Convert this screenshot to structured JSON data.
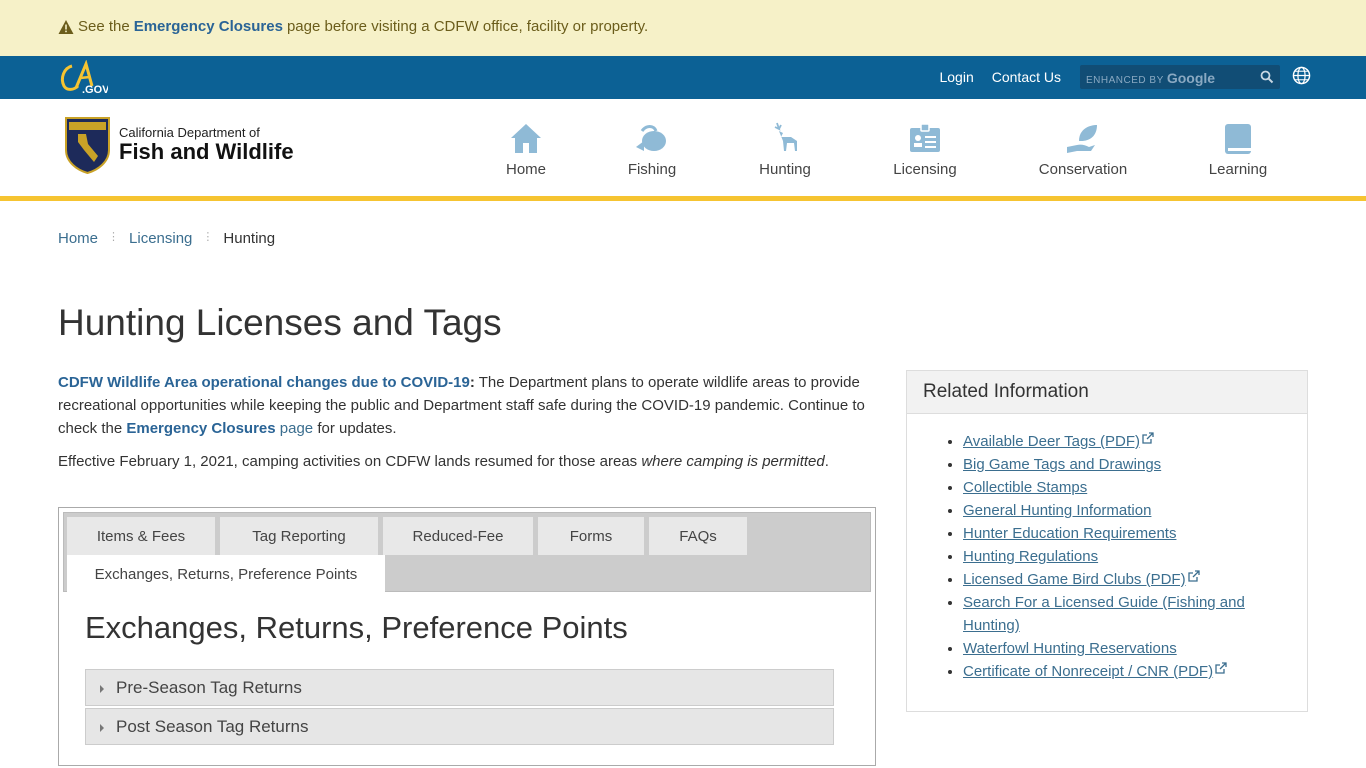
{
  "alert": {
    "prefix": "See the ",
    "link": "Emergency Closures",
    "suffix": " page before visiting a CDFW office, facility or property."
  },
  "topbar": {
    "logo_alt": "CA.GOV",
    "login": "Login",
    "contact": "Contact Us",
    "search_placeholder_small": "ENHANCED BY",
    "search_placeholder_brand": "Google"
  },
  "header": {
    "org_line1": "California Department of",
    "org_line2": "Fish and Wildlife",
    "nav": [
      {
        "label": "Home",
        "icon": "home-icon"
      },
      {
        "label": "Fishing",
        "icon": "fish-icon"
      },
      {
        "label": "Hunting",
        "icon": "deer-icon"
      },
      {
        "label": "Licensing",
        "icon": "id-card-icon"
      },
      {
        "label": "Conservation",
        "icon": "hand-leaf-icon"
      },
      {
        "label": "Learning",
        "icon": "book-icon"
      }
    ]
  },
  "breadcrumb": {
    "items": [
      "Home",
      "Licensing",
      "Hunting"
    ]
  },
  "page_title": "Hunting Licenses and Tags",
  "intro": {
    "covid_link": "CDFW Wildlife Area operational changes due to COVID-19",
    "covid_colon": ":",
    "covid_text": " The Department plans to operate wildlife areas to provide recreational opportunities while keeping the public and Department staff safe during the COVID-19 pandemic. Continue to check the ",
    "ec_link": "Emergency Closures",
    "page_link": " page",
    "for_updates": " for updates.",
    "camping_text": "Effective February 1, 2021, camping activities on CDFW lands resumed for those areas ",
    "camping_em": "where camping is permitted",
    "camping_end": "."
  },
  "tabs": {
    "items": [
      "Items & Fees",
      "Tag Reporting",
      "Reduced-Fee",
      "Forms",
      "FAQs",
      "Exchanges, Returns, Preference Points"
    ],
    "active_heading": "Exchanges, Returns, Preference Points",
    "accordions": [
      "Pre-Season Tag Returns",
      "Post Season Tag Returns"
    ]
  },
  "related": {
    "heading": "Related Information",
    "links": [
      {
        "label": "Available Deer Tags (PDF)",
        "external": true
      },
      {
        "label": "Big Game Tags and Drawings",
        "external": false
      },
      {
        "label": "Collectible Stamps",
        "external": false
      },
      {
        "label": "General Hunting Information",
        "external": false
      },
      {
        "label": "Hunter Education Requirements",
        "external": false
      },
      {
        "label": "Hunting Regulations",
        "external": false
      },
      {
        "label": "Licensed Game Bird Clubs (PDF)",
        "external": true
      },
      {
        "label": "Search For a Licensed Guide (Fishing and Hunting)",
        "external": false
      },
      {
        "label": "Waterfowl Hunting Reservations",
        "external": false
      },
      {
        "label": "Certificate of Nonreceipt / CNR (PDF)",
        "external": true
      }
    ]
  },
  "colors": {
    "alert_bg": "#f6f1c8",
    "topbar_bg": "#0c6195",
    "accent_gold": "#f6c431",
    "link": "#3b6e8f",
    "nav_icon": "#8fbad6"
  }
}
